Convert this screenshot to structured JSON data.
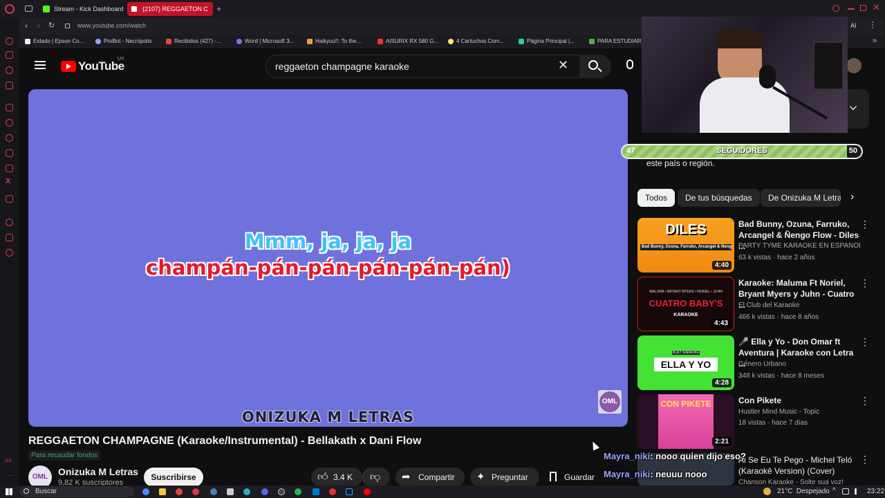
{
  "browser": {
    "tabs": [
      {
        "label": "Stream - Kick Dashboard",
        "active": false
      },
      {
        "label": "(2107) REGGAETON C",
        "active": true
      }
    ],
    "url": "www.youtube.com/watch",
    "bookmarks": [
      "Estado | Epson Co...",
      "ProBot - Necrópolis",
      "Recibidos (427) -...",
      "Word | Microsoft 3...",
      "Haikyuu!!: To the...",
      "AISURIX RX 580 G...",
      "4 Cartuchos Com...",
      "Página Principal |...",
      "PARA ESTUDIAR"
    ],
    "ai_label": "AI"
  },
  "youtube": {
    "logo_text": "YouTube",
    "country_code": "UY",
    "search_value": "reggaeton champagne karaoke"
  },
  "video": {
    "lyric_line1": "Mmm, ja, ja, ja",
    "lyric_line2": "champán-pán-pán-pán-pán-pán)",
    "watermark": "ONIZUKA M LETRAS",
    "badge": "OML",
    "title": "REGGAETON CHAMPAGNE (Karaoke/Instrumental) - Bellakath x Dani Flow",
    "fundraise_label": "Para recaudar fondos",
    "channel_name": "Onizuka M Letras",
    "channel_avatar": "OML",
    "subscribers": "9,82 K suscriptores",
    "subscribe_label": "Suscribirse",
    "likes": "3.4 K",
    "share_label": "Compartir",
    "ask_label": "Preguntar",
    "save_label": "Guardar"
  },
  "followers": {
    "left": "47",
    "label": "SEGUIDORES",
    "right": "50",
    "progress": 0.94
  },
  "sidebar": {
    "region_text": "este país o región.",
    "chips": [
      "Todos",
      "De tus búsquedas",
      "De Onizuka M Letra"
    ],
    "recommendations": [
      {
        "title": "Bad Bunny, Ozuna, Farruko, Arcangel & Ñengo Flow - Diles ...",
        "channel": "PARTY TYME KARAOKE EN ESPAÑOL",
        "meta": "63 k vistas · hace 2 años",
        "duration": "4:40",
        "thumb_text": "DILES",
        "thumb_sub": "Bad Bunny, Ozuna, Farruko, Arcangel & Ñengo Flow"
      },
      {
        "title": "Karaoke: Maluma Ft Noriel, Bryant Myers y Juhn - Cuatro ...",
        "channel": "El Club del Karaoke",
        "meta": "466 k vistas · hace 8 años",
        "duration": "4:43",
        "thumb_text": "CUATRO BABY'S",
        "thumb_sub": "MALUMA • BRYANT MYERS • NORIEL • JUHN",
        "thumb_sub2": "KARAOKE"
      },
      {
        "title": "🎤 Ella y Yo - Don Omar ft Aventura | Karaoke con Letra ...",
        "channel": "Género Urbano",
        "meta": "348 k vistas · hace 8 meses",
        "duration": "4:28",
        "thumb_text": "ELLA Y YO",
        "thumb_sub": "DUET KARAOKE"
      },
      {
        "title": "Con Pikete",
        "channel": "Hustler Mind Music - Topic",
        "meta": "18 vistas · hace 7 días",
        "duration": "2:21",
        "thumb_text": "CON PIKETE"
      },
      {
        "title": "Ai Se Eu Te Pego - Michel Teló (Karaokê Version) (Cover)",
        "channel": "Chanson Karaoke - Solte sua voz!",
        "meta": "",
        "duration": ""
      }
    ]
  },
  "chat": [
    {
      "user": "Mayra_niki",
      "message": ": nooo quien dijo eso?"
    },
    {
      "user": "Mayra_niki",
      "message": ": neuuu nooo"
    }
  ],
  "taskbar": {
    "search_placeholder": "Buscar",
    "weather": "21°C  Despejado",
    "time": "23:22"
  },
  "colors": {
    "video_bg": "#6f71dc",
    "accent_red": "#ff0000",
    "follower_fill": "#a8d27a"
  }
}
